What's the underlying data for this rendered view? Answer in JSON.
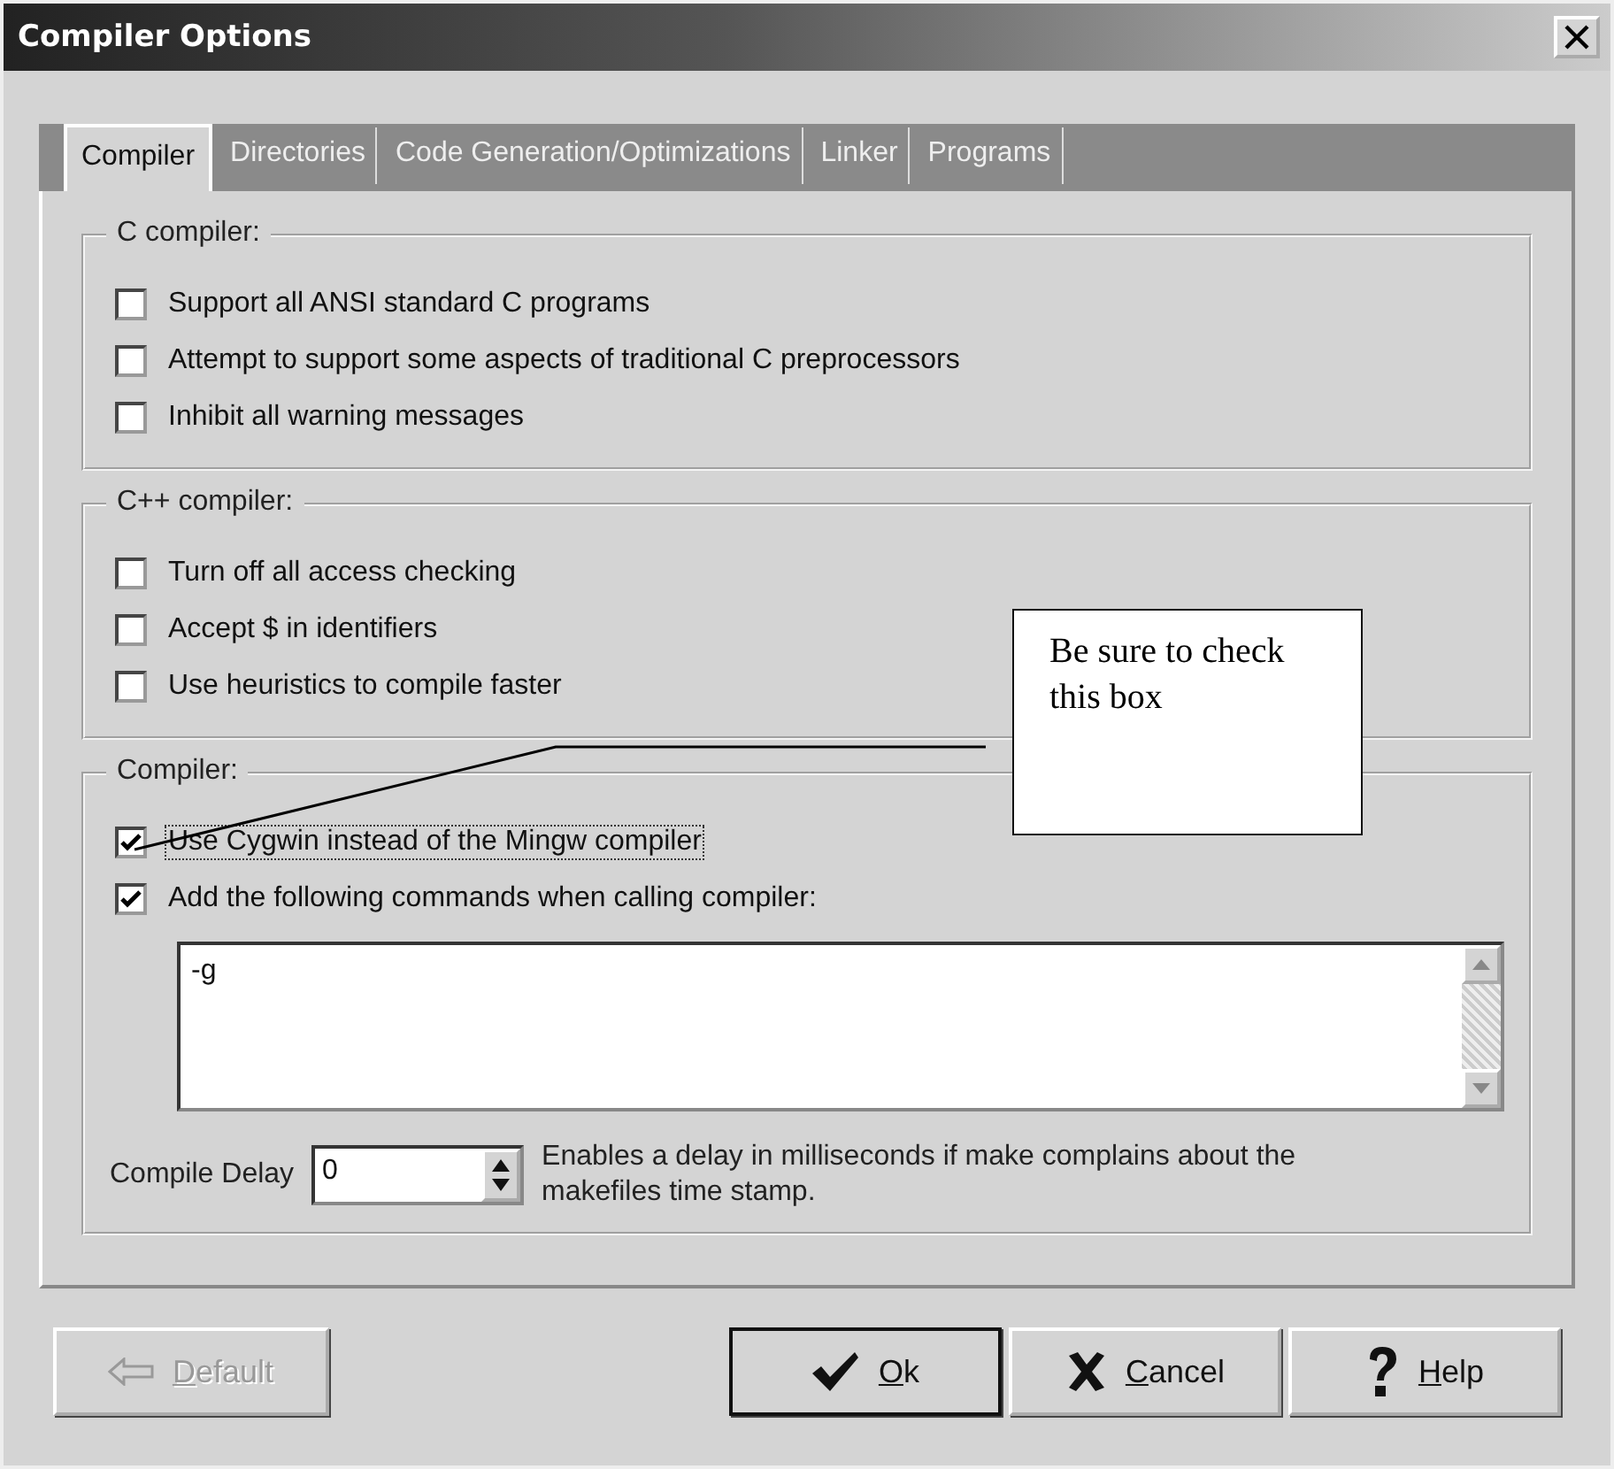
{
  "window": {
    "title": "Compiler Options"
  },
  "tabs": [
    {
      "label": "Compiler",
      "selected": true
    },
    {
      "label": "Directories",
      "selected": false
    },
    {
      "label": "Code Generation/Optimizations",
      "selected": false
    },
    {
      "label": "Linker",
      "selected": false
    },
    {
      "label": "Programs",
      "selected": false
    }
  ],
  "groups": [
    {
      "title": "C compiler:",
      "options": [
        {
          "label": "Support all ANSI standard C programs",
          "checked": false,
          "focused": false
        },
        {
          "label": "Attempt to support some aspects of traditional C preprocessors",
          "checked": false,
          "focused": false
        },
        {
          "label": "Inhibit all warning messages",
          "checked": false,
          "focused": false
        }
      ]
    },
    {
      "title": "C++ compiler:",
      "options": [
        {
          "label": "Turn off all access checking",
          "checked": false,
          "focused": false
        },
        {
          "label": "Accept $ in identifiers",
          "checked": false,
          "focused": false
        },
        {
          "label": "Use heuristics to compile faster",
          "checked": false,
          "focused": false
        }
      ]
    },
    {
      "title": "Compiler:",
      "options": [
        {
          "label": "Use Cygwin instead of the Mingw compiler",
          "checked": true,
          "focused": true
        },
        {
          "label": "Add the following commands when calling compiler:",
          "checked": true,
          "focused": false
        }
      ],
      "commands": {
        "value": "-g"
      },
      "delay": {
        "label": "Compile Delay",
        "value": "0",
        "hint": "Enables a delay in milliseconds if make complains about the makefiles time stamp."
      }
    }
  ],
  "callout": {
    "text": "Be sure to check this box"
  },
  "buttons": [
    {
      "label": "Default",
      "kind": "back",
      "disabled": true
    },
    {
      "label": "Ok",
      "kind": "ok",
      "disabled": false
    },
    {
      "label": "Cancel",
      "kind": "cancel",
      "disabled": false
    },
    {
      "label": "Help",
      "kind": "help",
      "disabled": false
    }
  ]
}
